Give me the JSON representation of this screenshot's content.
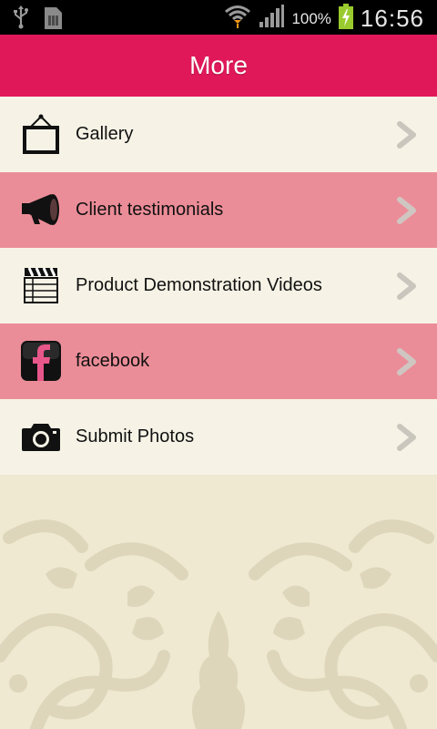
{
  "status_bar": {
    "battery_percent": "100%",
    "time": "16:56"
  },
  "header": {
    "title": "More"
  },
  "menu": {
    "items": [
      {
        "label": "Gallery",
        "icon": "picture-frame-icon"
      },
      {
        "label": "Client testimonials",
        "icon": "megaphone-icon"
      },
      {
        "label": "Product Demonstration Videos",
        "icon": "clapperboard-icon"
      },
      {
        "label": "facebook",
        "icon": "facebook-icon"
      },
      {
        "label": "Submit Photos",
        "icon": "camera-icon"
      }
    ]
  },
  "colors": {
    "header": "#e0185a",
    "row_light": "#f6f3e6",
    "row_pink": "#eb8d98",
    "background": "#efe9d2"
  }
}
